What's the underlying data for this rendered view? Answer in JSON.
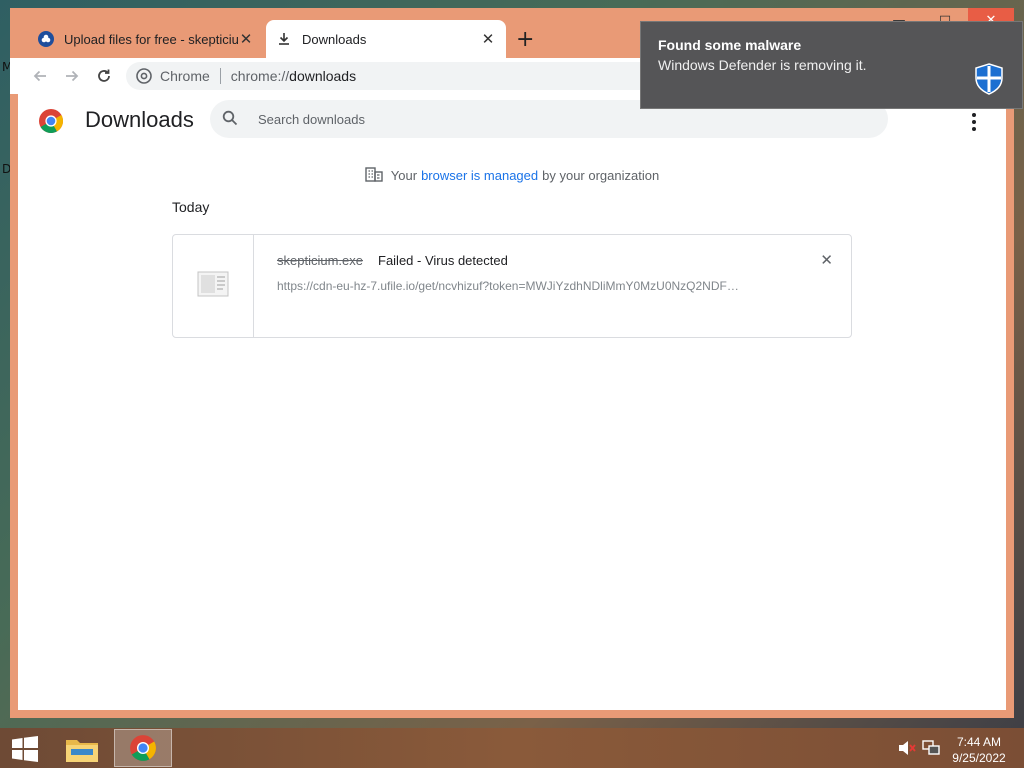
{
  "desktop": {
    "labels": [
      "M",
      "D"
    ]
  },
  "browser": {
    "window_controls": {
      "minimize": "—",
      "maximize": "□",
      "close": "✕"
    },
    "tabs": [
      {
        "title": "Upload files for free - skepticium",
        "favicon": "ufile-icon",
        "close": "✕"
      },
      {
        "title": "Downloads",
        "favicon": "download-icon",
        "close": "✕"
      }
    ],
    "new_tab_label": "+",
    "omnibox": {
      "chip_label": "Chrome",
      "url_scheme": "chrome://",
      "url_host": "downloads"
    }
  },
  "downloads_page": {
    "title": "Downloads",
    "search_placeholder": "Search downloads",
    "managed_notice": {
      "prefix": "Your",
      "link": "browser is managed",
      "suffix": "by your organization"
    },
    "date_heading": "Today",
    "items": [
      {
        "filename": "skepticium.exe",
        "status": "Failed - Virus detected",
        "url": "https://cdn-eu-hz-7.ufile.io/get/ncvhizuf?token=MWJiYzdhNDliMmY0MzU0NzQ2NDF…",
        "dismiss": "✕"
      }
    ]
  },
  "toast": {
    "title": "Found some malware",
    "message": "Windows Defender is removing it.",
    "icon": "defender-shield-icon",
    "accent": "#1c6fd1"
  },
  "taskbar": {
    "pinned": [
      "start-icon",
      "file-explorer-icon",
      "chrome-icon"
    ],
    "tray": [
      "volume-muted-icon",
      "network-icon"
    ],
    "clock": {
      "time": "7:44 AM",
      "date": "9/25/2022"
    }
  }
}
